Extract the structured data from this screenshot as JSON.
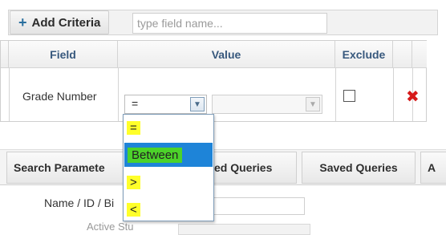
{
  "toolbar": {
    "add_criteria_label": "Add Criteria",
    "field_search_placeholder": "type field name..."
  },
  "table": {
    "headers": [
      "Field",
      "Value",
      "Exclude"
    ],
    "row": {
      "field": "Grade Number",
      "operator": "=",
      "value": "",
      "exclude": false
    }
  },
  "operator_options": [
    "=",
    "Between",
    ">",
    "<"
  ],
  "operator_highlighted": "Between",
  "tabs": [
    "Search Parameters",
    "Saved Queries",
    "Saved Queries",
    "Ad"
  ],
  "tabs_visible": [
    "Search Paramete",
    "ed Queries",
    "Saved Queries",
    "A"
  ],
  "search": {
    "name_label_visible": "Name / ID / Bi",
    "partial_label": "Active Stu"
  },
  "colors": {
    "highlight_yellow": "#ffff2a",
    "highlight_green": "#4cd22a",
    "selected_blue": "#1e84d8",
    "remove_red": "#d61a1a"
  }
}
